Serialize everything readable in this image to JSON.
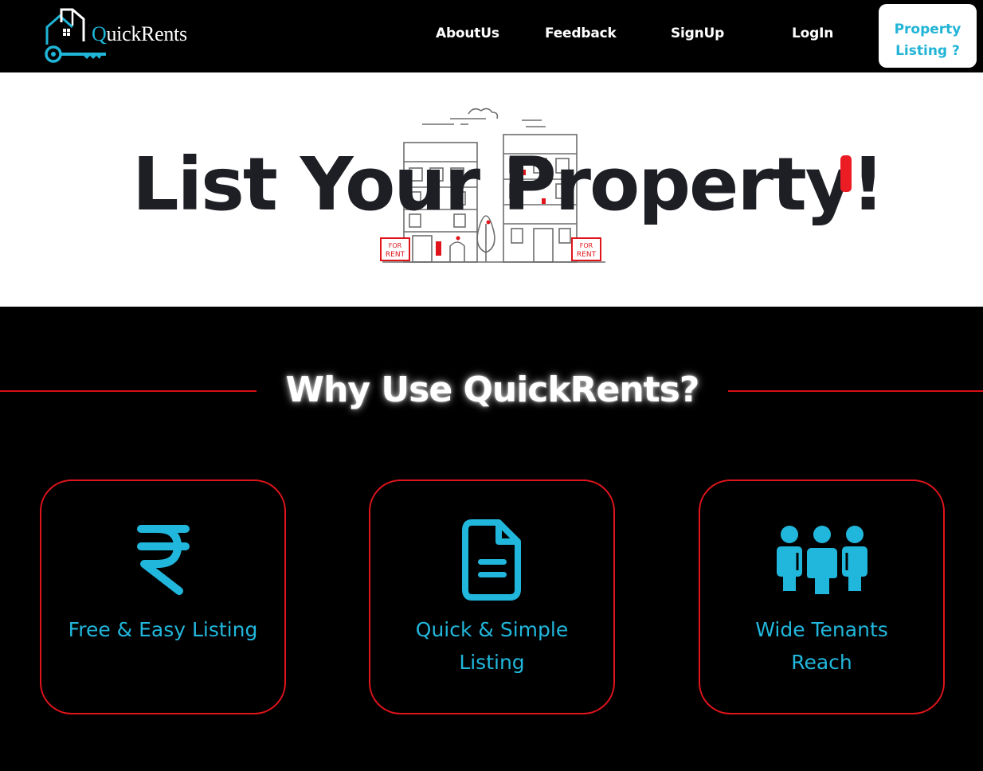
{
  "brand": {
    "name_prefix": "Q",
    "name_rest": "uickRents",
    "accent_color": "#1fb6d8",
    "logo_icon": "house-key-icon"
  },
  "nav": {
    "about": "AboutUs",
    "feedback": "Feedback",
    "signup": "SignUp",
    "login": "LogIn",
    "cta": "Property Listing ?"
  },
  "hero": {
    "title": "List Your Property!",
    "illustration_text": {
      "sign_left_line1": "FOR",
      "sign_left_line2": "RENT",
      "sign_right_line1": "FOR",
      "sign_right_line2": "RENT"
    }
  },
  "why": {
    "title": "Why Use QuickRents?",
    "line_color": "#d80f16"
  },
  "features": [
    {
      "icon": "rupee-icon",
      "label": "Free & Easy Listing"
    },
    {
      "icon": "document-icon",
      "label": "Quick & Simple Listing"
    },
    {
      "icon": "users-group-icon",
      "label": "Wide Tenants Reach"
    }
  ],
  "colors": {
    "background": "#000000",
    "hero_background": "#ffffff",
    "card_border": "#e0141b",
    "feature_text": "#21b7dc",
    "cta_text": "#21b4d6"
  }
}
